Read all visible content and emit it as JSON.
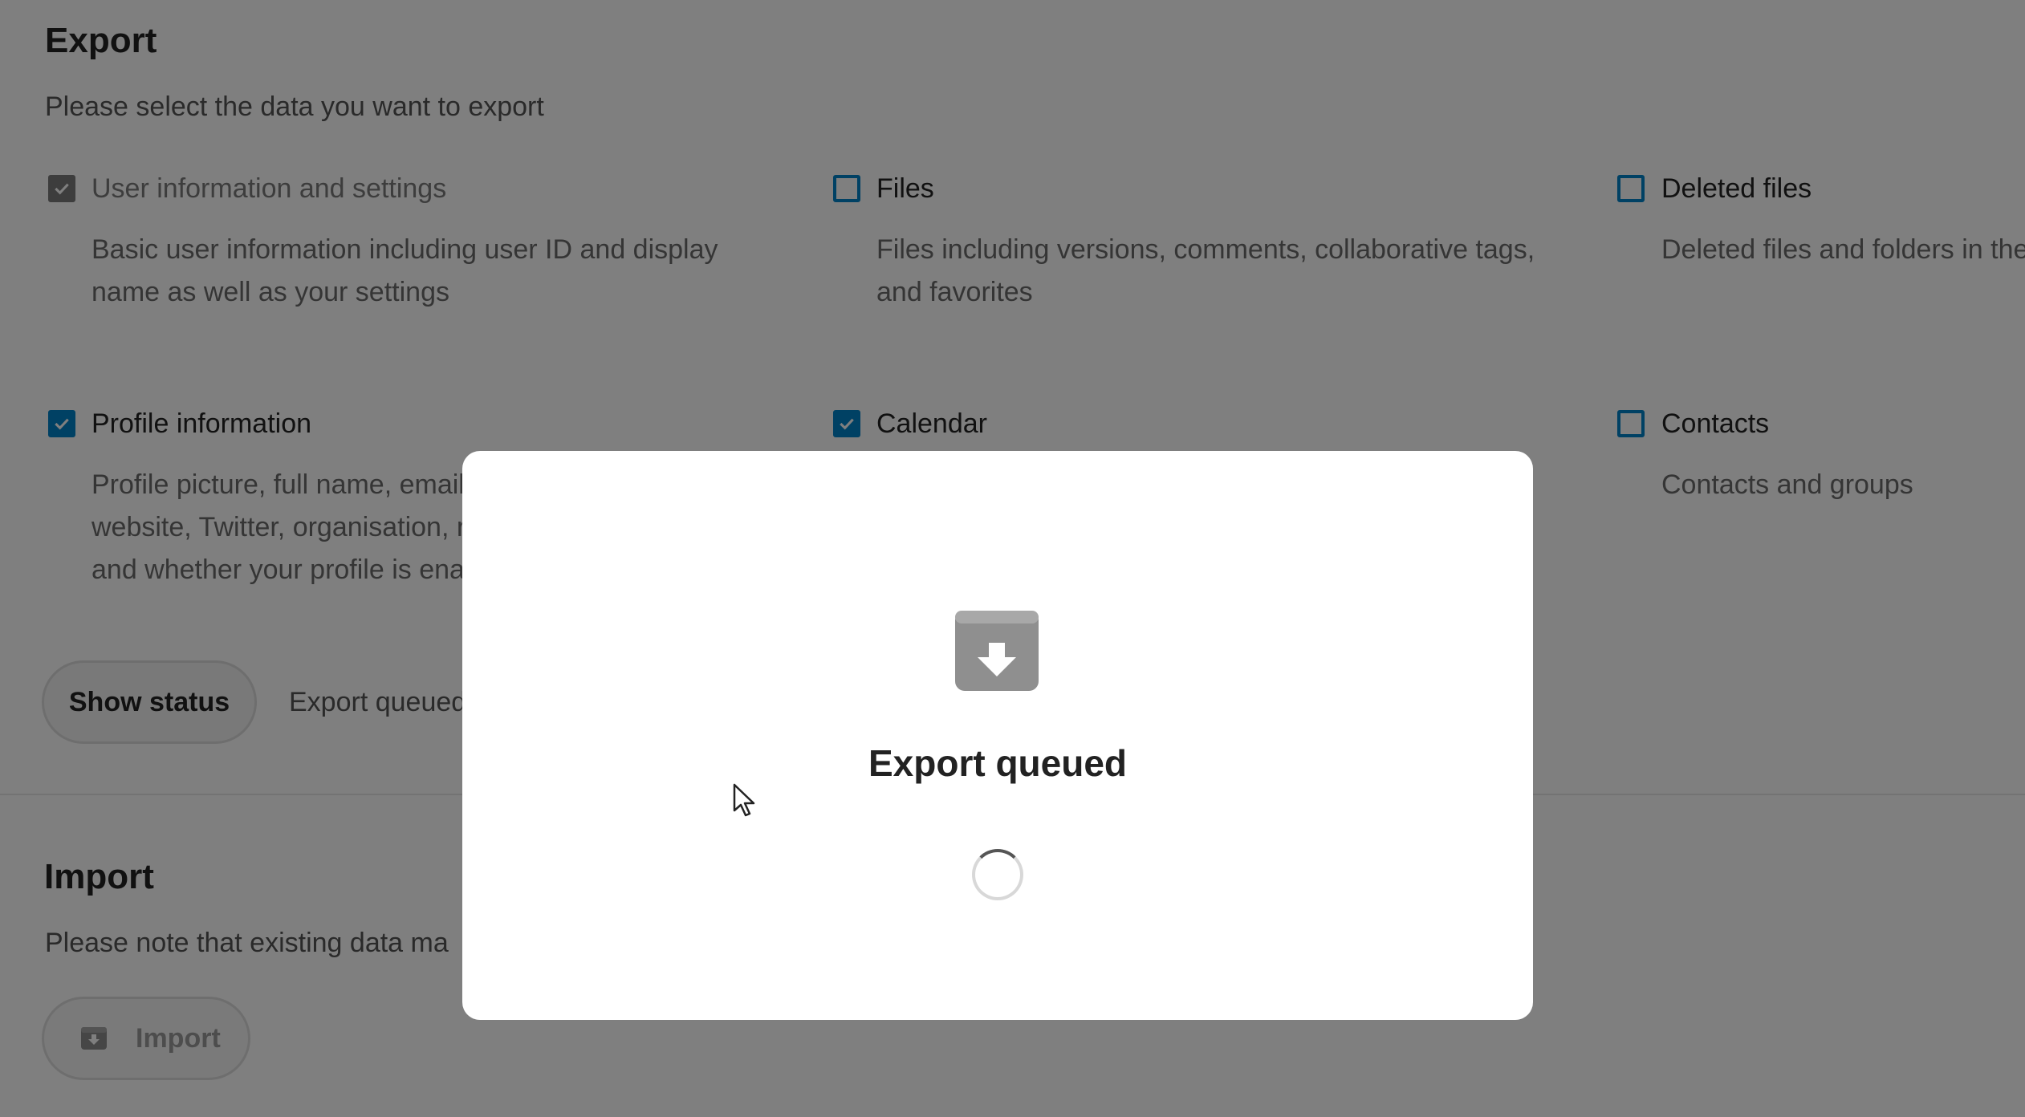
{
  "export_section": {
    "title": "Export",
    "description": "Please select the data you want to export",
    "options": [
      {
        "label": "User information and settings",
        "description": "Basic user information including user ID and display name as well as your settings",
        "checked": true,
        "disabled": true
      },
      {
        "label": "Files",
        "description": "Files including versions, comments, collaborative tags, and favorites",
        "checked": false,
        "disabled": false
      },
      {
        "label": "Deleted files",
        "description": "Deleted files and folders in the",
        "checked": false,
        "disabled": false
      },
      {
        "label": "Profile information",
        "description": "Profile picture, full name, email, website, Twitter, organisation, ro and whether your profile is enal",
        "line1": "Profile picture, full name, email,",
        "line2": "website, Twitter, organisation, ro",
        "line3": "and whether your profile is enal",
        "checked": true,
        "disabled": false
      },
      {
        "label": "Calendar",
        "description": "",
        "checked": true,
        "disabled": false
      },
      {
        "label": "Contacts",
        "description": "Contacts and groups",
        "checked": false,
        "disabled": false
      }
    ],
    "show_status_button": "Show status",
    "status_text": "Export queued"
  },
  "import_section": {
    "title": "Import",
    "description": "Please note that existing data ma",
    "import_button": "Import"
  },
  "modal": {
    "title": "Export queued",
    "icon": "archive-download-icon",
    "spinner": "loading-spinner"
  },
  "colors": {
    "accent": "#0082c9",
    "overlay": "rgba(0,0,0,0.5)"
  }
}
